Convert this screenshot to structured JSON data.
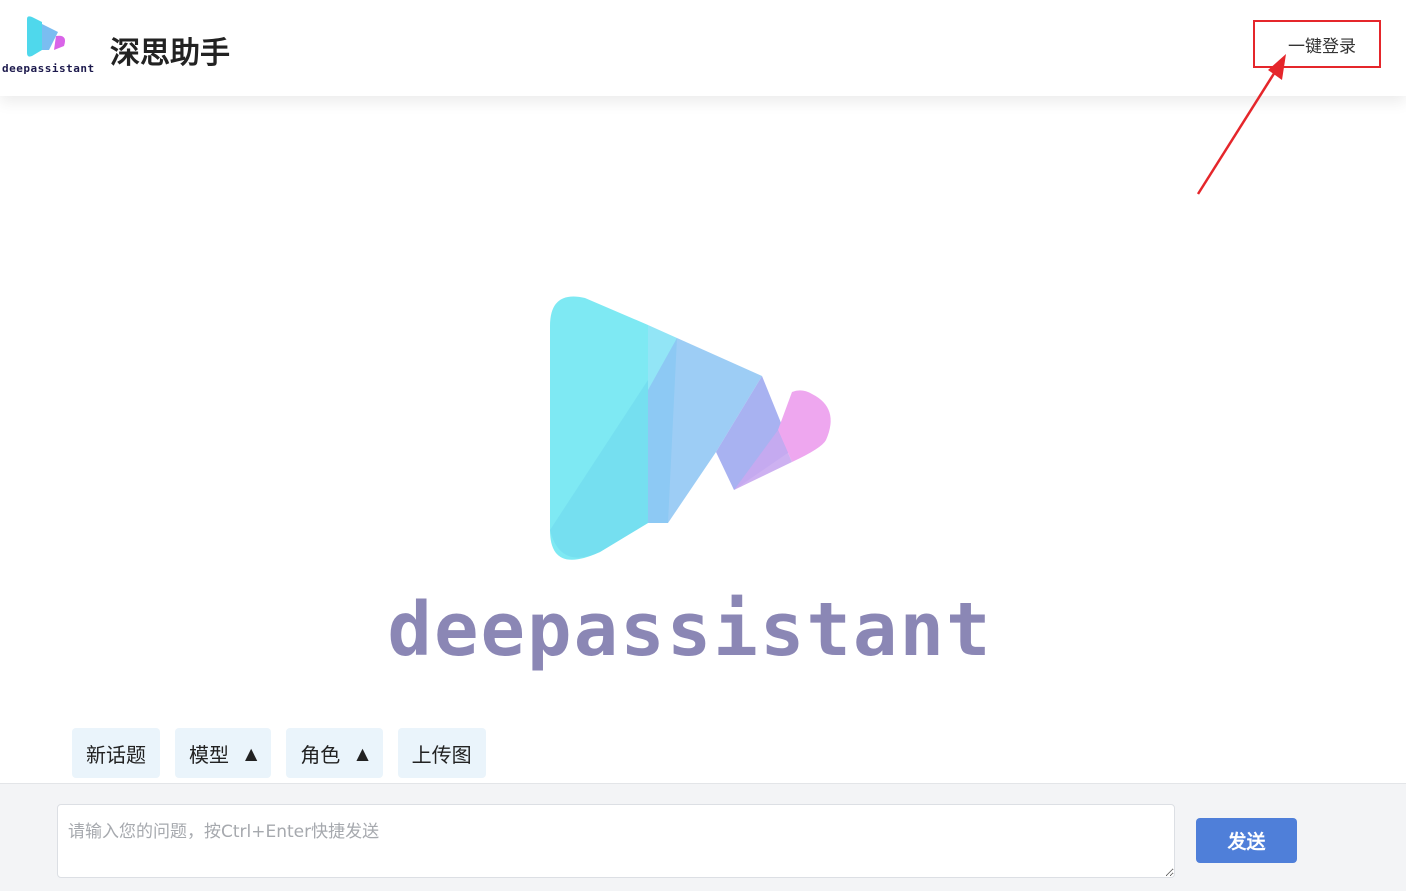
{
  "header": {
    "brand_text": "deepassistant",
    "app_title": "深思助手",
    "login_label": "一键登录"
  },
  "hero": {
    "wordmark": "deepassistant"
  },
  "toolbar": {
    "new_topic_label": "新话题",
    "model_label": "模型",
    "model_caret": "▲",
    "role_label": "角色",
    "role_caret": "▲",
    "upload_label": "上传图"
  },
  "composer": {
    "placeholder": "请输入您的问题，按Ctrl+Enter快捷发送",
    "value": "",
    "send_label": "发送"
  },
  "colors": {
    "accent": "#4f7fd9",
    "annotation": "#e5262b",
    "wordmark": "#8b87b5",
    "toolbar_bg": "#eaf4fb"
  }
}
